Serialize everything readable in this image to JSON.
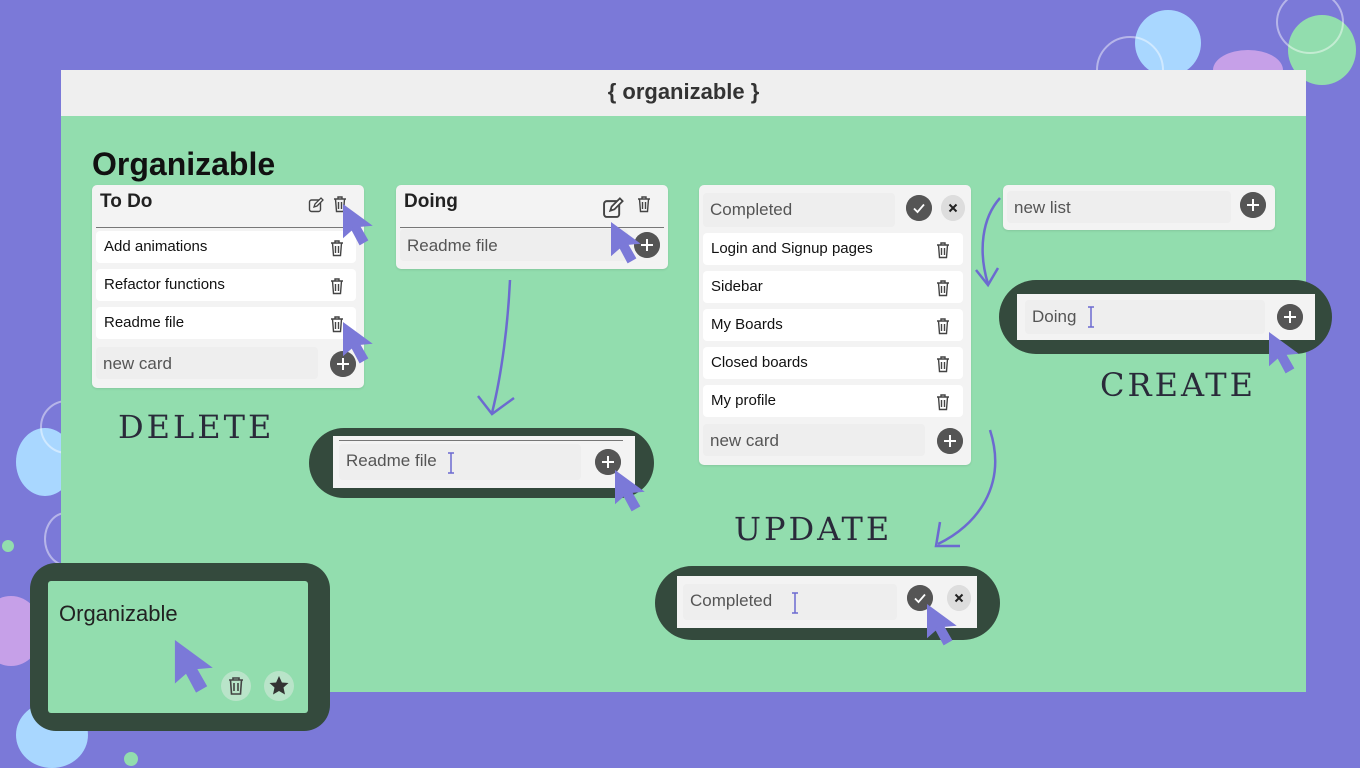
{
  "app": {
    "title": "{ organizable }"
  },
  "board": {
    "title": "Organizable"
  },
  "lists": {
    "todo": {
      "title": "To Do",
      "cards": [
        "Add animations",
        "Refactor functions",
        "Readme file"
      ],
      "new_card_placeholder": "new card"
    },
    "doing": {
      "title": "Doing",
      "input_value": "Readme file"
    },
    "completed": {
      "title_input": "Completed",
      "cards": [
        "Login and Signup pages",
        "Sidebar",
        "My Boards",
        "Closed boards",
        "My profile"
      ],
      "new_card_placeholder": "new card"
    },
    "new_list": {
      "placeholder": "new list"
    }
  },
  "zooms": {
    "create_value": "Doing",
    "readme_value": "Readme file",
    "update_value": "Completed",
    "board_card_title": "Organizable"
  },
  "captions": {
    "delete": "DELETE",
    "create": "CREATE",
    "update": "UPDATE"
  },
  "colors": {
    "background": "#7b79d8",
    "board": "#92ddae",
    "accent": "#7b79d8",
    "dark_frame": "#344a3d",
    "button": "#555555"
  },
  "icons": [
    "edit-icon",
    "trash-icon",
    "plus-icon",
    "check-icon",
    "close-icon",
    "star-icon",
    "cursor-icon",
    "text-caret-icon"
  ]
}
